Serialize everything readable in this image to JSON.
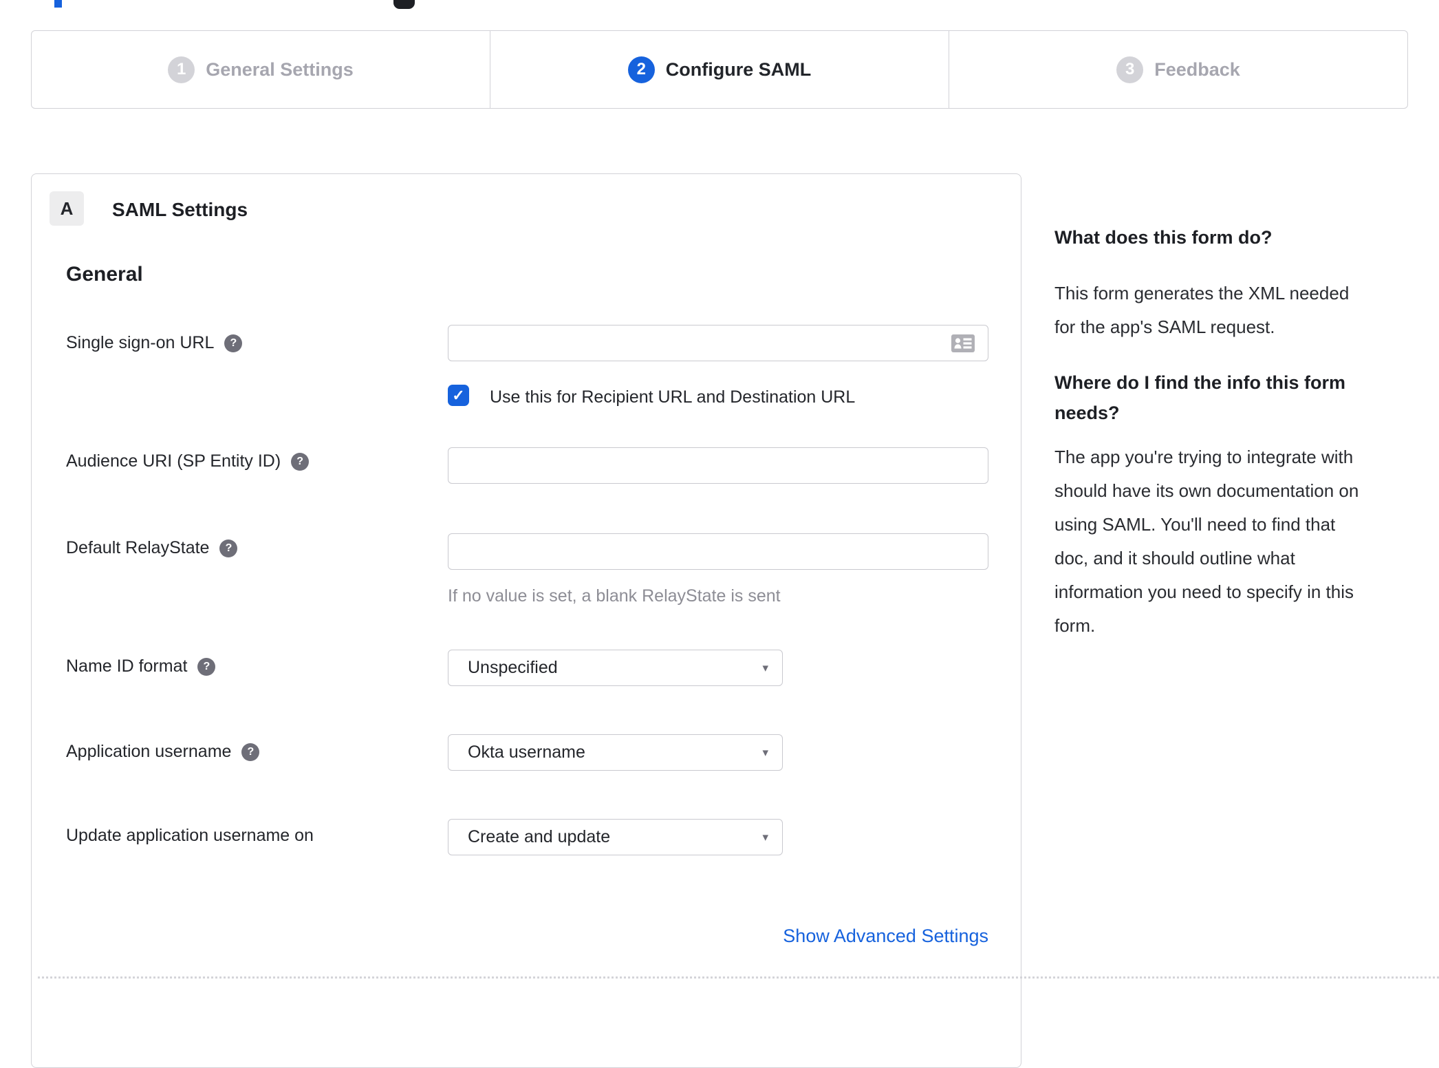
{
  "stepper": {
    "steps": [
      {
        "number": "1",
        "label": "General Settings",
        "state": "inactive"
      },
      {
        "number": "2",
        "label": "Configure SAML",
        "state": "active"
      },
      {
        "number": "3",
        "label": "Feedback",
        "state": "inactive"
      }
    ]
  },
  "panel": {
    "section_badge": "A",
    "section_title": "SAML Settings",
    "subsection_title": "General",
    "fields": [
      {
        "label": "Single sign-on URL",
        "value": "",
        "checkbox_label": "Use this for Recipient URL and Destination URL",
        "checkbox_checked": true
      },
      {
        "label": "Audience URI (SP Entity ID)",
        "value": ""
      },
      {
        "label": "Default RelayState",
        "value": "",
        "hint": "If no value is set, a blank RelayState is sent"
      },
      {
        "label": "Name ID format",
        "value": "Unspecified"
      },
      {
        "label": "Application username",
        "value": "Okta username"
      },
      {
        "label": "Update application username on",
        "value": "Create and update"
      }
    ],
    "advanced_link_label": "Show Advanced Settings"
  },
  "sidebar": {
    "heading1": "What does this form do?",
    "para1_lines": [
      "This form generates the XML needed",
      "for the app's SAML request."
    ],
    "heading2_lines": [
      "Where do I find the info this form",
      "needs?"
    ],
    "para2_lines": [
      "The app you're trying to integrate with",
      "should have its own documentation on",
      "using SAML. You'll need to find that",
      "doc, and it should outline what",
      "information you need to specify in this",
      "form."
    ]
  },
  "icons": {
    "help_glyph": "?",
    "check_glyph": "✓",
    "caret_glyph": "▾"
  },
  "colors": {
    "accent_blue": "#1662dd",
    "inactive_gray": "#d3d3d8",
    "border_gray": "#d2d2d7",
    "text_dark": "#24262b",
    "hint_gray": "#8d8d95"
  }
}
